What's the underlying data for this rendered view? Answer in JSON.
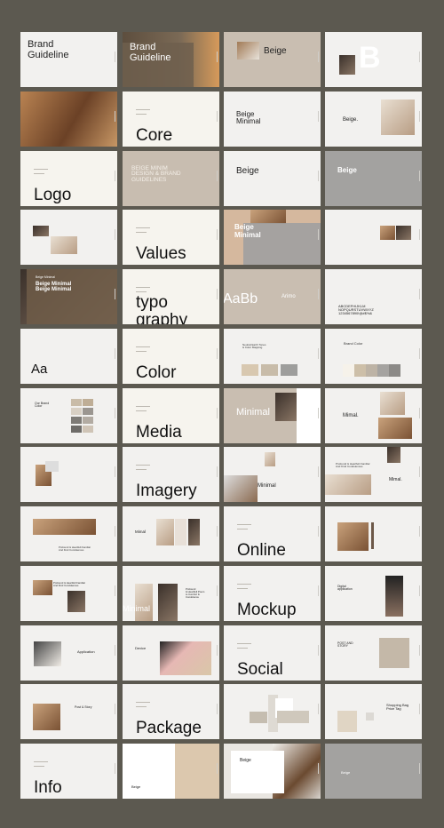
{
  "colors": {
    "page_background": "#5c5950",
    "light": "#f2f1ef",
    "cream": "#f6f4ee",
    "beige": "#c9beb1",
    "grey": "#a3a2a0"
  },
  "slides": [
    {
      "title": "Brand\nGuideline",
      "bg": "#f2f1ef"
    },
    {
      "title": "Brand\nGuideline",
      "bg": "#6f5e4c"
    },
    {
      "title": "Beige",
      "bg": "#c9beb1"
    },
    {
      "title": "B",
      "bg": "#f2f1ef"
    },
    {
      "title": "",
      "bg": "#9c6a42"
    },
    {
      "title": "Core",
      "bg": "#f6f4ee"
    },
    {
      "title": "Beige\nMinimal",
      "bg": "#f2f1ef"
    },
    {
      "title": "Beige.",
      "bg": "#f2f1ef"
    },
    {
      "title": "Logo",
      "bg": "#f6f4ee"
    },
    {
      "title": "BEIGE MINIM\nDESIGN & BRAND\nGUIDELINES",
      "bg": "#c8bdb0"
    },
    {
      "title": "Beige",
      "bg": "#f2f1ef"
    },
    {
      "title": "Beige",
      "bg": "#a3a2a0"
    },
    {
      "title": "",
      "bg": "#f2f1ef"
    },
    {
      "title": "Values",
      "bg": "#f6f4ee"
    },
    {
      "title": "Beige\nMinimal",
      "bg": "#d5b89e"
    },
    {
      "title": "",
      "bg": "#f2f1ef"
    },
    {
      "title": "Beige Minimal",
      "subtitle": "Beige Minimal\nBeige Minimal",
      "bg": "#5a4838"
    },
    {
      "title": "typo\ngraphy",
      "bg": "#f6f4ee"
    },
    {
      "title": "AaBb",
      "subtitle": "Arimo",
      "bg": "#c9beb1"
    },
    {
      "title": "ABCDEFHIJKLM\nNOPQURSTUVWXYZ\n1234567890!@#$%&",
      "bg": "#f2f1ef"
    },
    {
      "title": "Aa",
      "bg": "#f2f1ef"
    },
    {
      "title": "Color",
      "bg": "#f6f4ee"
    },
    {
      "title": "Neutral Earth Tones\n& Color Mapping",
      "bg": "#f2f1ef"
    },
    {
      "title": "Brand Color",
      "bg": "#f2f1ef"
    },
    {
      "title": "Our Brand\nColor",
      "bg": "#f2f1ef"
    },
    {
      "title": "Media",
      "bg": "#f6f4ee"
    },
    {
      "title": "Minimal",
      "bg": "#c9beb1"
    },
    {
      "title": "Mimal.",
      "bg": "#f2f1ef"
    },
    {
      "title": "",
      "bg": "#f2f1ef"
    },
    {
      "title": "Imagery",
      "bg": "#f2f1ef"
    },
    {
      "title": "Minimal",
      "bg": "#f2f1ef"
    },
    {
      "title": "Mimal.",
      "subtitle": "Profound & Heartfelt Familiar\nAnd Kind Condolences",
      "bg": "#f2f1ef"
    },
    {
      "title": "Profound & Heartfelt Familiar\nAnd Kind Condolences",
      "bg": "#f2f1ef"
    },
    {
      "title": "Mimal",
      "bg": "#f2f1ef"
    },
    {
      "title": "Online",
      "bg": "#f2f1ef"
    },
    {
      "title": "",
      "bg": "#f2f1ef"
    },
    {
      "title": "Profound & Heartfelt Familiar\nAnd Kind Condolences",
      "bg": "#f2f1ef"
    },
    {
      "title": "Profound\n& Heartfelt Poem\nto Comfort &\nCondolence",
      "subtitle": "Minimal",
      "bg": "#f2f1ef"
    },
    {
      "title": "Mockup",
      "bg": "#f2f1ef"
    },
    {
      "title": "Digital\napplication",
      "bg": "#f2f1ef"
    },
    {
      "title": "Application",
      "bg": "#f2f1ef"
    },
    {
      "title": "Device",
      "bg": "#f2f1ef"
    },
    {
      "title": "Social",
      "bg": "#f2f1ef"
    },
    {
      "title": "POST AND\nSTORY",
      "bg": "#f2f1ef"
    },
    {
      "title": "Post & Story",
      "bg": "#f2f1ef"
    },
    {
      "title": "Package",
      "bg": "#f2f1ef"
    },
    {
      "title": "",
      "bg": "#f2f1ef"
    },
    {
      "title": "Shopping Bag\nPrice Tag",
      "bg": "#f2f1ef"
    },
    {
      "title": "Info",
      "bg": "#f2f1ef"
    },
    {
      "title": "Beige",
      "bg": "#ffffff"
    },
    {
      "title": "Beige",
      "bg": "#e9e6e1"
    },
    {
      "title": "Beige",
      "bg": "#a3a2a0"
    }
  ]
}
